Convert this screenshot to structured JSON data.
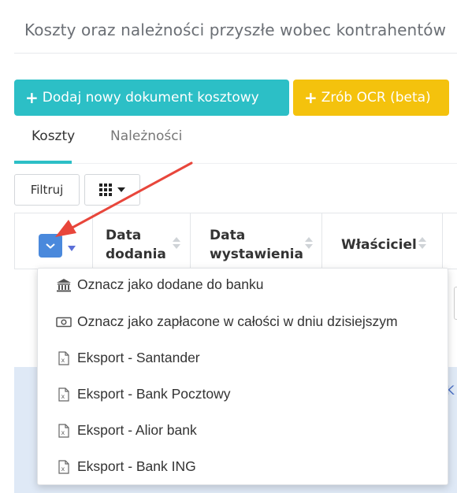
{
  "header": {
    "title": "Koszty oraz należności przyszłe wobec kontrahentów"
  },
  "actions": {
    "add_document": "Dodaj nowy dokument kosztowy",
    "ocr": "Zrób OCR (beta)"
  },
  "tabs": [
    {
      "label": "Koszty",
      "active": true
    },
    {
      "label": "Należności",
      "active": false
    }
  ],
  "toolbar": {
    "filter_label": "Filtruj"
  },
  "table": {
    "columns": [
      {
        "label_line1": "Data",
        "label_line2": "dodania"
      },
      {
        "label_line1": "Data",
        "label_line2": "wystawienia"
      },
      {
        "label_line1": "Właściciel",
        "label_line2": ""
      }
    ]
  },
  "bulk_menu": {
    "items": [
      {
        "label": "Oznacz jako dodane do banku",
        "icon": "bank-icon"
      },
      {
        "label": "Oznacz jako zapłacone w całości w dniu dzisiejszym",
        "icon": "money-icon"
      },
      {
        "label": "Eksport - Santander",
        "icon": "excel-file-icon"
      },
      {
        "label": "Eksport - Bank Pocztowy",
        "icon": "excel-file-icon"
      },
      {
        "label": "Eksport - Alior bank",
        "icon": "excel-file-icon"
      },
      {
        "label": "Eksport - Bank ING",
        "icon": "excel-file-icon"
      }
    ]
  },
  "colors": {
    "accent": "#2cbfc6",
    "ocr": "#f4c20d",
    "select": "#4a89dc",
    "arrow": "#e8463b",
    "row_highlight": "#dfe9f6"
  }
}
